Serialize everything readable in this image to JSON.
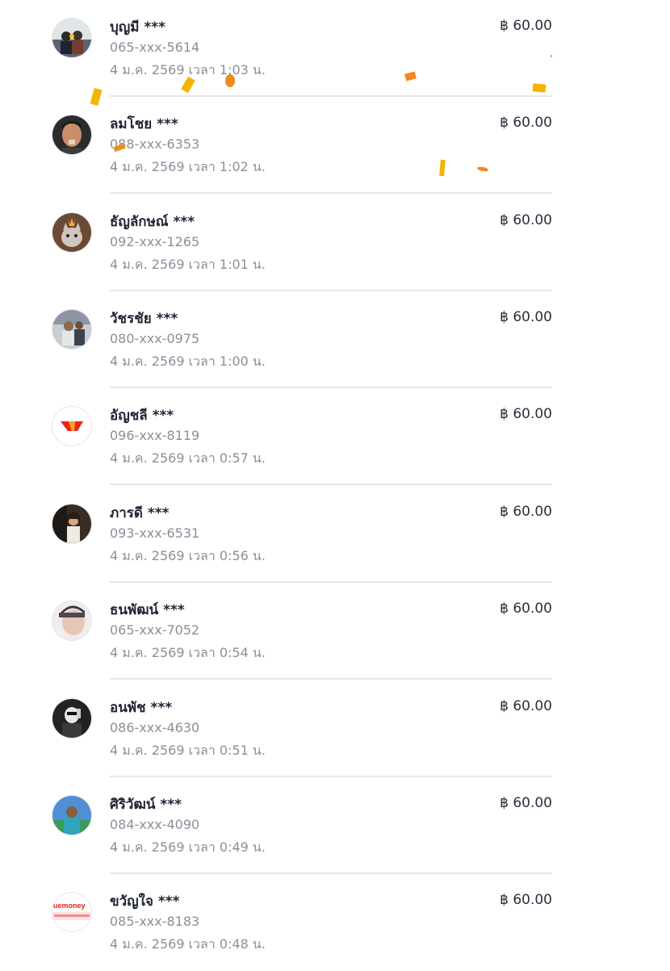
{
  "colors": {
    "name_text": "#1f2433",
    "secondary_text": "#8a8f99",
    "amount_text": "#2a2f3d",
    "divider": "#e6e7eb",
    "confetti_yellow": "#f4b400",
    "confetti_orange": "#f08a1c"
  },
  "transactions": [
    {
      "name": "บุญมี ***",
      "phone": "065-xxx-5614",
      "datetime": "4 ม.ค. 2569 เวลา 1:03 น.",
      "amount": "฿ 60.00",
      "avatar_icon": "person-photo-icon"
    },
    {
      "name": "ลมโชย ***",
      "phone": "088-xxx-6353",
      "datetime": "4 ม.ค. 2569 เวลา 1:02 น.",
      "amount": "฿ 60.00",
      "avatar_icon": "person-photo-icon"
    },
    {
      "name": "ธัญลักษณ์ ***",
      "phone": "092-xxx-1265",
      "datetime": "4 ม.ค. 2569 เวลา 1:01 น.",
      "amount": "฿ 60.00",
      "avatar_icon": "pet-photo-icon"
    },
    {
      "name": "วัชรชัย ***",
      "phone": "080-xxx-0975",
      "datetime": "4 ม.ค. 2569 เวลา 1:00 น.",
      "amount": "฿ 60.00",
      "avatar_icon": "person-photo-icon"
    },
    {
      "name": "อัญชลี ***",
      "phone": "096-xxx-8119",
      "datetime": "4 ม.ค. 2569 เวลา 0:57 น.",
      "amount": "฿ 60.00",
      "avatar_icon": "wallet-logo-icon"
    },
    {
      "name": "ภารดี ***",
      "phone": "093-xxx-6531",
      "datetime": "4 ม.ค. 2569 เวลา 0:56 น.",
      "amount": "฿ 60.00",
      "avatar_icon": "person-photo-icon"
    },
    {
      "name": "ธนพัฒน์ ***",
      "phone": "065-xxx-7052",
      "datetime": "4 ม.ค. 2569 เวลา 0:54 น.",
      "amount": "฿ 60.00",
      "avatar_icon": "person-photo-icon"
    },
    {
      "name": "อนพัช ***",
      "phone": "086-xxx-4630",
      "datetime": "4 ม.ค. 2569 เวลา 0:51 น.",
      "amount": "฿ 60.00",
      "avatar_icon": "person-photo-icon"
    },
    {
      "name": "ศิริวัฒน์ ***",
      "phone": "084-xxx-4090",
      "datetime": "4 ม.ค. 2569 เวลา 0:49 น.",
      "amount": "฿ 60.00",
      "avatar_icon": "person-photo-icon"
    },
    {
      "name": "ขวัญใจ ***",
      "phone": "085-xxx-8183",
      "datetime": "4 ม.ค. 2569 เวลา 0:48 น.",
      "amount": "฿ 60.00",
      "avatar_icon": "truemoney-logo-icon",
      "avatar_text": "uemoney"
    }
  ]
}
